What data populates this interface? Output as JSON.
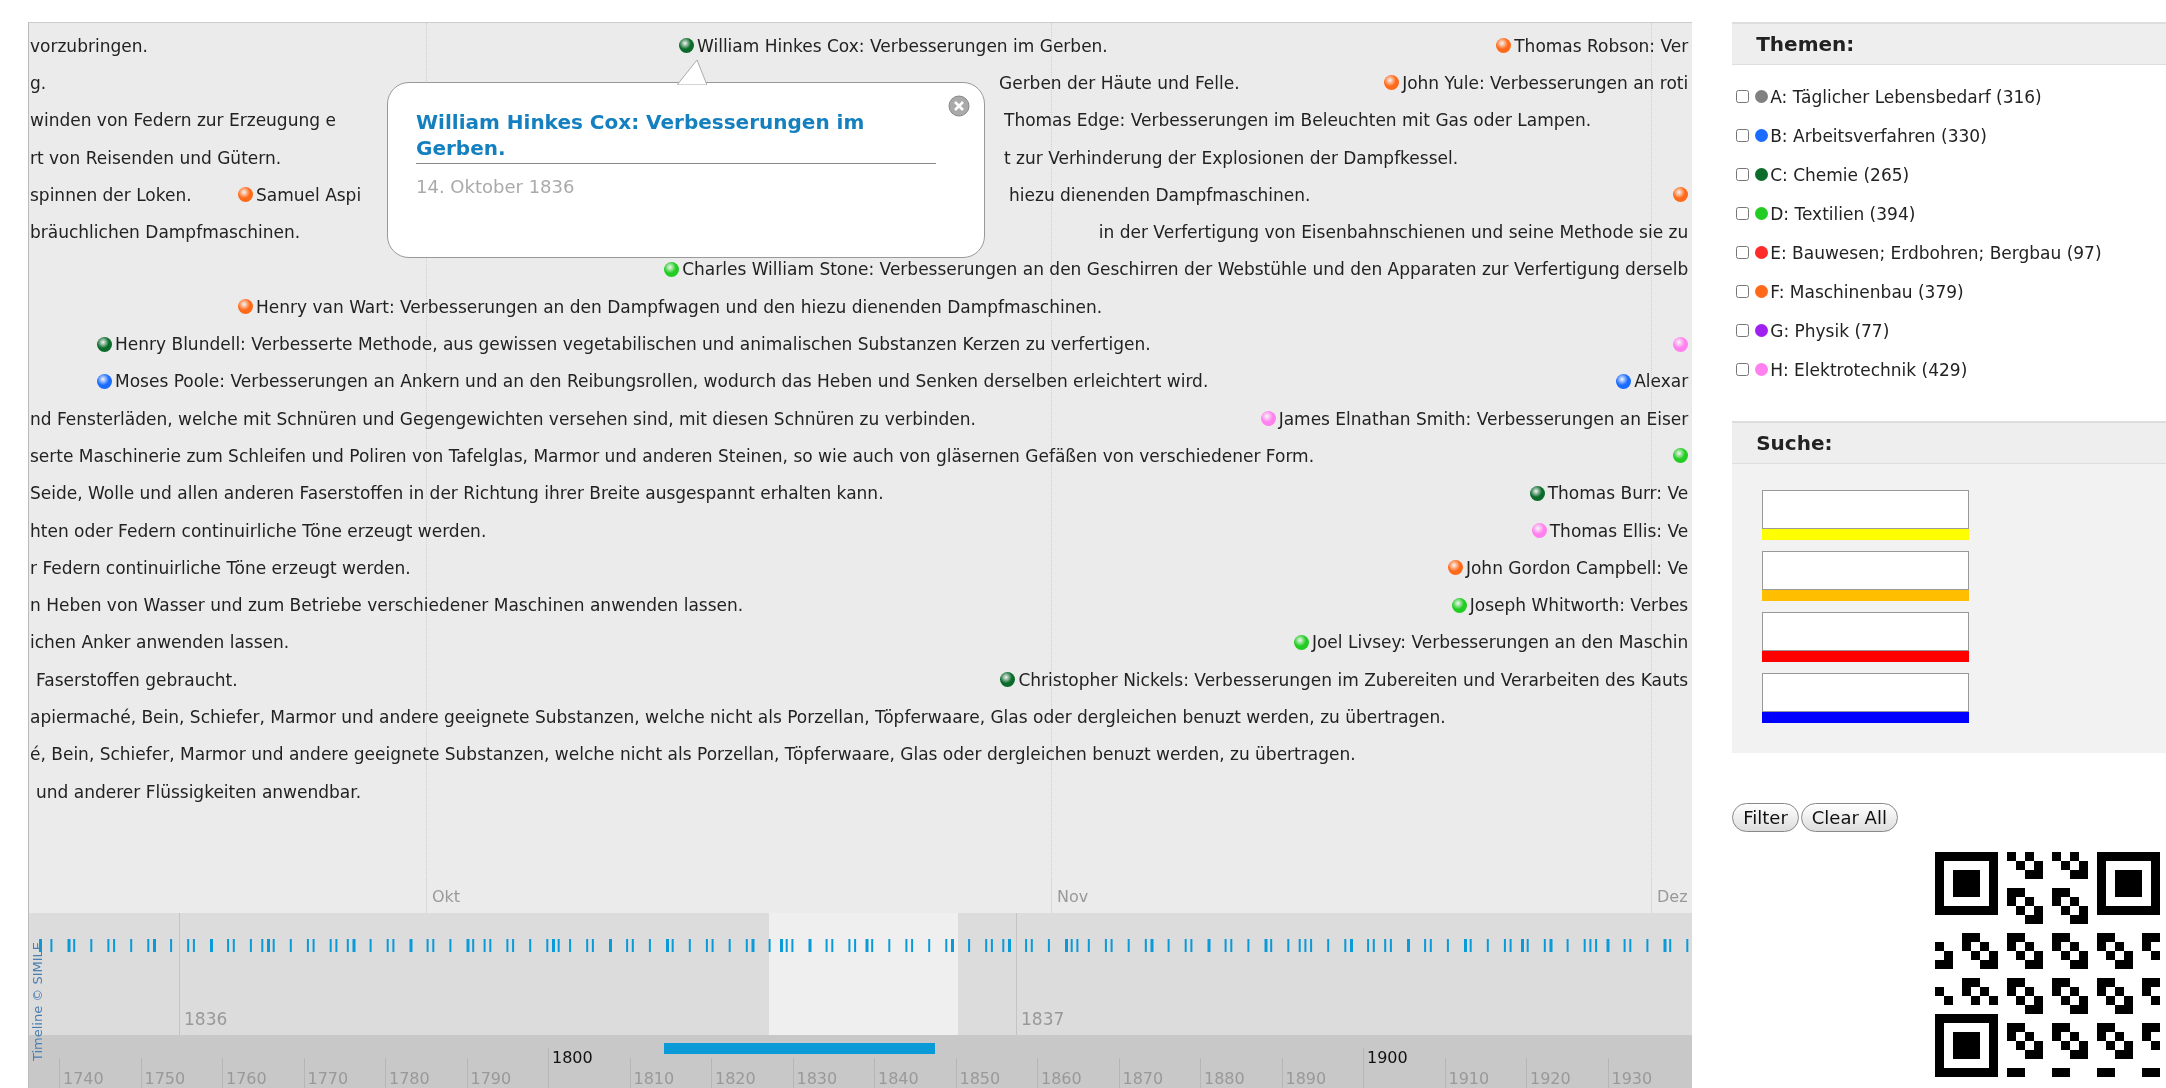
{
  "timeline": {
    "rows": [
      {
        "events": [
          {
            "text": "vorzubringen."
          },
          {
            "text": "William Hinkes Cox: Verbesserungen im Gerben.",
            "color": "#0a6b2a"
          },
          {
            "text": "Thomas Robson: Ver",
            "color": "#ff6a1a"
          }
        ]
      },
      {
        "events": [
          {
            "text": "g."
          },
          {
            "text": "Gerben der Häute und Felle."
          },
          {
            "text": "John Yule: Verbesserungen an roti",
            "color": "#ff6a1a"
          }
        ]
      },
      {
        "events": [
          {
            "text": "winden von Federn zur Erzeugung e"
          },
          {
            "text": "Thomas Edge: Verbesserungen im Beleuchten mit Gas oder Lampen."
          }
        ]
      },
      {
        "events": [
          {
            "text": "rt von Reisenden und Gütern."
          },
          {
            "text": "t zur Verhinderung der Explosionen der Dampfkessel."
          }
        ]
      },
      {
        "events": [
          {
            "text": "spinnen der Loken."
          },
          {
            "text": "Samuel Aspi",
            "color": "#ff6a1a"
          },
          {
            "text": "hiezu dienenden Dampfmaschinen."
          },
          {
            "color": "#ff6a1a"
          }
        ]
      },
      {
        "events": [
          {
            "text": "bräuchlichen Dampfmaschinen."
          },
          {
            "text": "in der Verfertigung von Eisenbahnschienen und seine Methode sie zu"
          }
        ]
      },
      {
        "events": [
          {
            "text": "Charles William Stone: Verbesserungen an den Geschirren der Webstühle und den Apparaten zur Verfertigung derselb",
            "color": "#22cc22"
          }
        ]
      },
      {
        "events": [
          {
            "text": "Henry van Wart: Verbesserungen an den Dampfwagen und den hiezu dienenden Dampfmaschinen.",
            "color": "#ff6a1a"
          }
        ]
      },
      {
        "events": [
          {
            "text": "Henry Blundell: Verbesserte Methode, aus gewissen vegetabilischen und animalischen Substanzen Kerzen zu verfertigen.",
            "color": "#0a6b2a"
          },
          {
            "color": "#ff80ee"
          }
        ]
      },
      {
        "events": [
          {
            "text": "Moses Poole: Verbesserungen an Ankern und an den Reibungsrollen, wodurch das Heben und Senken derselben erleichtert wird.",
            "color": "#1a6bff"
          },
          {
            "text": "Alexar",
            "color": "#1a6bff"
          }
        ]
      },
      {
        "events": [
          {
            "text": "nd Fensterläden, welche mit Schnüren und Gegengewichten versehen sind, mit diesen Schnüren zu verbinden."
          },
          {
            "text": "James Elnathan Smith: Verbesserungen an Eiser",
            "color": "#ff80ee"
          }
        ]
      },
      {
        "events": [
          {
            "text": "serte Maschinerie zum Schleifen und Poliren von Tafelglas, Marmor und anderen Steinen, so wie auch von gläsernen Gefäßen von verschiedener Form."
          },
          {
            "color": "#22cc22"
          }
        ]
      },
      {
        "events": [
          {
            "text": "Seide, Wolle und allen anderen Faserstoffen in der Richtung ihrer Breite ausgespannt erhalten kann."
          },
          {
            "text": "Thomas Burr: Ve",
            "color": "#0a6b2a"
          }
        ]
      },
      {
        "events": [
          {
            "text": "hten oder Federn continuirliche Töne erzeugt werden."
          },
          {
            "text": "Thomas Ellis: Ve",
            "color": "#ff80ee"
          }
        ]
      },
      {
        "events": [
          {
            "text": "r Federn continuirliche Töne erzeugt werden."
          },
          {
            "text": "John Gordon Campbell: Ve",
            "color": "#ff6a1a"
          }
        ]
      },
      {
        "events": [
          {
            "text": "n Heben von Wasser und zum Betriebe verschiedener Maschinen anwenden lassen."
          },
          {
            "text": "Joseph Whitworth: Verbes",
            "color": "#22cc22"
          }
        ]
      },
      {
        "events": [
          {
            "text": "ichen Anker anwenden lassen."
          },
          {
            "text": "Joel Livsey: Verbesserungen an den Maschin",
            "color": "#22cc22"
          }
        ]
      },
      {
        "events": [
          {
            "text": "Faserstoffen gebraucht."
          },
          {
            "text": "Christopher Nickels: Verbesserungen im Zubereiten und Verarbeiten des Kauts",
            "color": "#0a6b2a"
          }
        ]
      },
      {
        "events": [
          {
            "text": "apiermaché, Bein, Schiefer, Marmor und andere geeignete Substanzen, welche nicht als Porzellan, Töpferwaare, Glas oder dergleichen benuzt werden, zu übertragen."
          }
        ]
      },
      {
        "events": [
          {
            "text": "é, Bein, Schiefer, Marmor und andere geeignete Substanzen, welche nicht als Porzellan, Töpferwaare, Glas oder dergleichen benuzt werden, zu übertragen."
          }
        ]
      },
      {
        "events": [
          {
            "text": "und anderer Flüssigkeiten anwendbar."
          }
        ]
      }
    ],
    "popup": {
      "title": "William Hinkes Cox: Verbesserungen im Gerben.",
      "date": "14. Oktober 1836"
    },
    "months": [
      "Okt",
      "Nov",
      "Dez"
    ],
    "years": [
      "1836",
      "1837"
    ],
    "decades": [
      {
        "text": "1740",
        "kind": "minor"
      },
      {
        "text": "1750",
        "kind": "minor"
      },
      {
        "text": "1760",
        "kind": "minor"
      },
      {
        "text": "1770",
        "kind": "minor"
      },
      {
        "text": "1780",
        "kind": "minor"
      },
      {
        "text": "1790",
        "kind": "minor"
      },
      {
        "text": "1800",
        "kind": "major"
      },
      {
        "text": "1810",
        "kind": "minor"
      },
      {
        "text": "1820",
        "kind": "minor"
      },
      {
        "text": "1830",
        "kind": "minor"
      },
      {
        "text": "1840",
        "kind": "minor"
      },
      {
        "text": "1850",
        "kind": "minor"
      },
      {
        "text": "1860",
        "kind": "minor"
      },
      {
        "text": "1870",
        "kind": "minor"
      },
      {
        "text": "1880",
        "kind": "minor"
      },
      {
        "text": "1890",
        "kind": "minor"
      },
      {
        "text": "1900",
        "kind": "major"
      },
      {
        "text": "1910",
        "kind": "minor"
      },
      {
        "text": "1920",
        "kind": "minor"
      },
      {
        "text": "1930",
        "kind": "minor"
      }
    ],
    "credit": "Timeline © SIMILE"
  },
  "themes": {
    "title": "Themen:",
    "items": [
      {
        "label": "A: Täglicher Lebensbedarf (316)",
        "color": "#808080",
        "checked": false
      },
      {
        "label": "B: Arbeitsverfahren (330)",
        "color": "#1a6bff",
        "checked": false
      },
      {
        "label": "C: Chemie (265)",
        "color": "#0a6b2a",
        "checked": false
      },
      {
        "label": "D: Textilien (394)",
        "color": "#22cc22",
        "checked": false
      },
      {
        "label": "E: Bauwesen; Erdbohren; Bergbau (97)",
        "color": "#ff2a2a",
        "checked": false
      },
      {
        "label": "F: Maschinenbau (379)",
        "color": "#ff6a1a",
        "checked": false
      },
      {
        "label": "G: Physik (77)",
        "color": "#a020f0",
        "checked": false
      },
      {
        "label": "H: Elektrotechnik (429)",
        "color": "#ff80ee",
        "checked": false
      }
    ]
  },
  "search": {
    "title": "Suche:",
    "fields": [
      {
        "color": "#ffff00"
      },
      {
        "color": "#ffbf00"
      },
      {
        "color": "#ff0000"
      },
      {
        "color": "#0000ff"
      }
    ]
  },
  "buttons": [
    "Filter",
    "Clear All"
  ]
}
